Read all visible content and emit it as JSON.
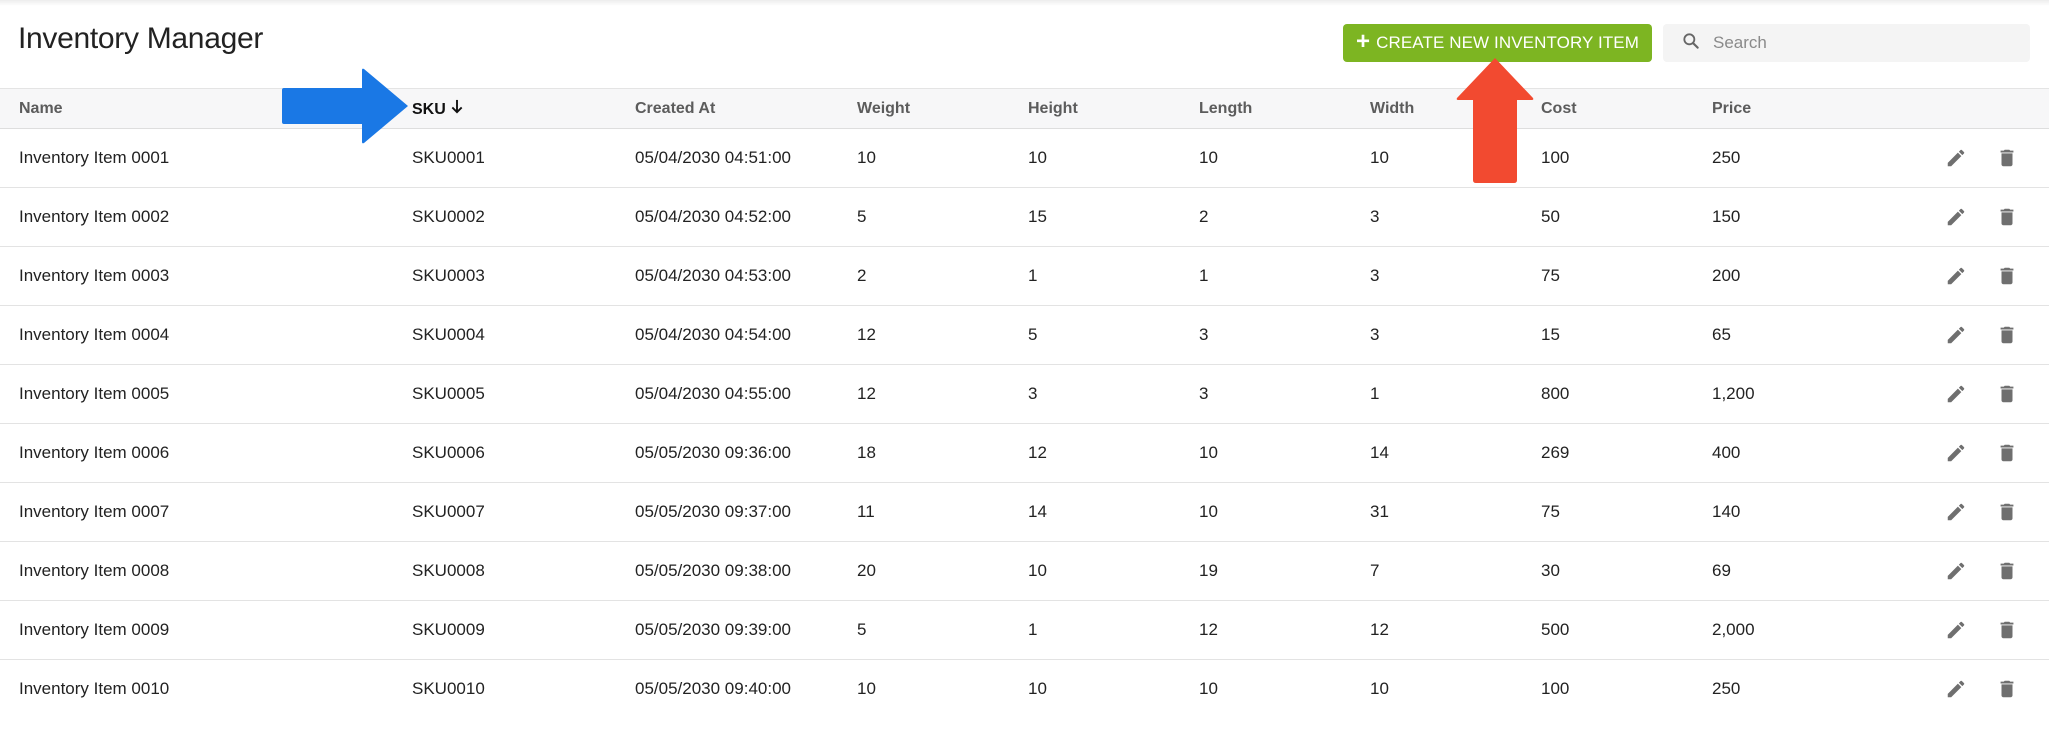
{
  "header": {
    "title": "Inventory Manager",
    "create_button_label": "CREATE NEW INVENTORY ITEM",
    "create_button_icon": "plus-icon",
    "search_placeholder": "Search",
    "search_value": "",
    "search_icon": "search-icon"
  },
  "colors": {
    "create_button": "#7db522",
    "annotation_blue": "#1a78e5",
    "annotation_red": "#f24a30",
    "header_bg": "#f7f7f8",
    "icon_gray": "#6f6f6f"
  },
  "table": {
    "columns": [
      {
        "key": "name",
        "label": "Name"
      },
      {
        "key": "sku",
        "label": "SKU",
        "sorted": "descending",
        "sort_icon": "arrow-down-icon"
      },
      {
        "key": "created_at",
        "label": "Created At"
      },
      {
        "key": "weight",
        "label": "Weight"
      },
      {
        "key": "height",
        "label": "Height"
      },
      {
        "key": "length",
        "label": "Length"
      },
      {
        "key": "width",
        "label": "Width"
      },
      {
        "key": "cost",
        "label": "Cost"
      },
      {
        "key": "price",
        "label": "Price"
      }
    ],
    "row_actions": [
      {
        "name": "edit",
        "icon": "pencil-icon"
      },
      {
        "name": "delete",
        "icon": "trash-icon"
      }
    ],
    "rows": [
      {
        "name": "Inventory Item 0001",
        "sku": "SKU0001",
        "created_at": "05/04/2030 04:51:00",
        "weight": "10",
        "height": "10",
        "length": "10",
        "width": "10",
        "cost": "100",
        "price": "250"
      },
      {
        "name": "Inventory Item 0002",
        "sku": "SKU0002",
        "created_at": "05/04/2030 04:52:00",
        "weight": "5",
        "height": "15",
        "length": "2",
        "width": "3",
        "cost": "50",
        "price": "150"
      },
      {
        "name": "Inventory Item 0003",
        "sku": "SKU0003",
        "created_at": "05/04/2030 04:53:00",
        "weight": "2",
        "height": "1",
        "length": "1",
        "width": "3",
        "cost": "75",
        "price": "200"
      },
      {
        "name": "Inventory Item 0004",
        "sku": "SKU0004",
        "created_at": "05/04/2030 04:54:00",
        "weight": "12",
        "height": "5",
        "length": "3",
        "width": "3",
        "cost": "15",
        "price": "65"
      },
      {
        "name": "Inventory Item 0005",
        "sku": "SKU0005",
        "created_at": "05/04/2030 04:55:00",
        "weight": "12",
        "height": "3",
        "length": "3",
        "width": "1",
        "cost": "800",
        "price": "1,200"
      },
      {
        "name": "Inventory Item 0006",
        "sku": "SKU0006",
        "created_at": "05/05/2030 09:36:00",
        "weight": "18",
        "height": "12",
        "length": "10",
        "width": "14",
        "cost": "269",
        "price": "400"
      },
      {
        "name": "Inventory Item 0007",
        "sku": "SKU0007",
        "created_at": "05/05/2030 09:37:00",
        "weight": "11",
        "height": "14",
        "length": "10",
        "width": "31",
        "cost": "75",
        "price": "140"
      },
      {
        "name": "Inventory Item 0008",
        "sku": "SKU0008",
        "created_at": "05/05/2030 09:38:00",
        "weight": "20",
        "height": "10",
        "length": "19",
        "width": "7",
        "cost": "30",
        "price": "69"
      },
      {
        "name": "Inventory Item 0009",
        "sku": "SKU0009",
        "created_at": "05/05/2030 09:39:00",
        "weight": "5",
        "height": "1",
        "length": "12",
        "width": "12",
        "cost": "500",
        "price": "2,000"
      },
      {
        "name": "Inventory Item 0010",
        "sku": "SKU0010",
        "created_at": "05/05/2030 09:40:00",
        "weight": "10",
        "height": "10",
        "length": "10",
        "width": "10",
        "cost": "100",
        "price": "250"
      }
    ]
  },
  "annotations": [
    {
      "type": "arrow",
      "direction": "right",
      "color": "blue",
      "points_to": "sku-column-header"
    },
    {
      "type": "arrow",
      "direction": "up",
      "color": "red",
      "points_to": "create-new-inventory-item-button"
    }
  ]
}
